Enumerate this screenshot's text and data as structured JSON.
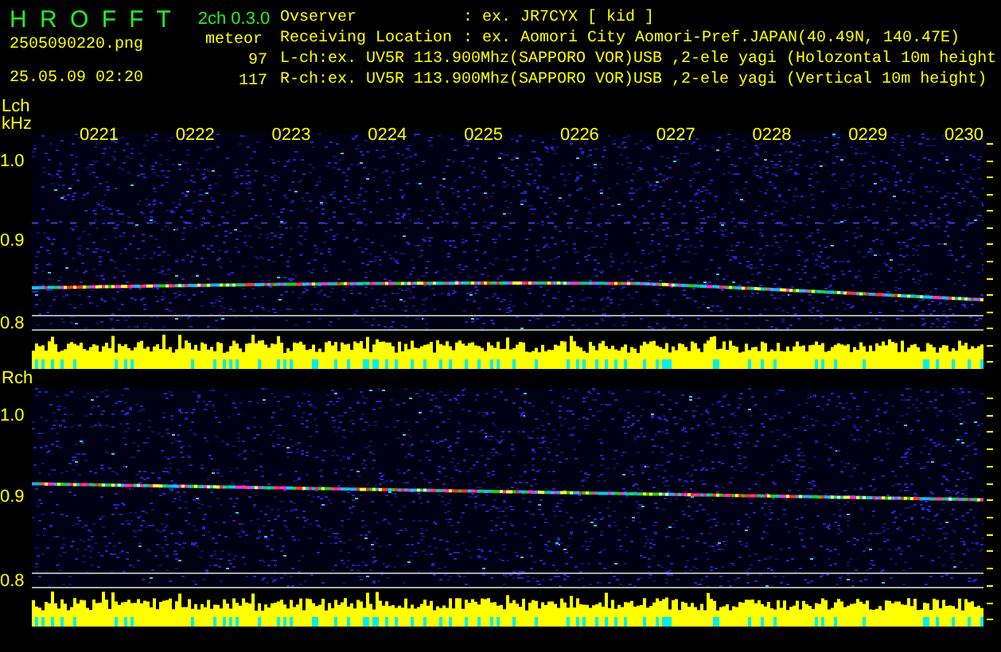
{
  "app": {
    "title": "H R O F F T",
    "version": "2ch 0.3.0",
    "filename": "2505090220.png",
    "datetime": "25.05.09 02:20",
    "count_label": "meteor",
    "counts": [
      "97",
      "117"
    ]
  },
  "info": [
    {
      "label": "Ovserver",
      "value": ": ex. JR7CYX [ kid ]"
    },
    {
      "label": "Receiving Location",
      "value": ": ex. Aomori City Aomori-Pref.JAPAN(40.49N, 140.47E)"
    }
  ],
  "channel_lines": [
    "L-ch:ex. UV5R 113.900Mhz(SAPPORO VOR)USB ,2-ele yagi (Holozontal 10m height",
    "R-ch:ex. UV5R 113.900Mhz(SAPPORO VOR)USB ,2-ele yagi (Vertical 10m height)"
  ],
  "channels": [
    {
      "label": "Lch",
      "unit": "kHz",
      "yticks": [
        "1.0",
        "0.9",
        "0.8"
      ],
      "time_labels": [
        "0221",
        "0222",
        "0223",
        "0224",
        "0225",
        "0226",
        "0227",
        "0228",
        "0229",
        "0230"
      ]
    },
    {
      "label": "Rch",
      "yticks": [
        "1.0",
        "0.9",
        "0.8"
      ]
    }
  ]
}
